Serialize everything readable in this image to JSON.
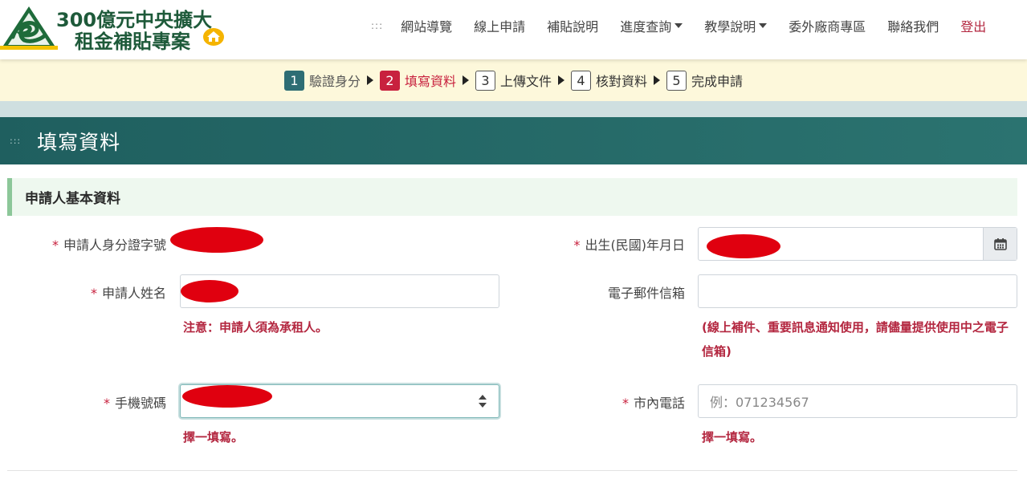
{
  "logo": {
    "line1": "300億元中央擴大",
    "line2": "租金補貼專案"
  },
  "nav": {
    "dots": ":::",
    "items": [
      {
        "label": "網站導覽",
        "dropdown": false
      },
      {
        "label": "線上申請",
        "dropdown": false
      },
      {
        "label": "補貼說明",
        "dropdown": false
      },
      {
        "label": "進度查詢",
        "dropdown": true
      },
      {
        "label": "教學說明",
        "dropdown": true
      },
      {
        "label": "委外廠商專區",
        "dropdown": false
      }
    ],
    "contact": "聯絡我們",
    "logout": "登出"
  },
  "steps": [
    {
      "num": "1",
      "label": "驗證身分",
      "state": "done"
    },
    {
      "num": "2",
      "label": "填寫資料",
      "state": "active"
    },
    {
      "num": "3",
      "label": "上傳文件",
      "state": "pending"
    },
    {
      "num": "4",
      "label": "核對資料",
      "state": "pending"
    },
    {
      "num": "5",
      "label": "完成申請",
      "state": "pending"
    }
  ],
  "page": {
    "dots": ":::",
    "title": "填寫資料"
  },
  "section": {
    "title": "申請人基本資料"
  },
  "form": {
    "required_mark": "*",
    "id_label": "申請人身分證字號",
    "birth_label": "出生(民國)年月日",
    "name_label": "申請人姓名",
    "name_note": "注意：申請人須為承租人。",
    "email_label": "電子郵件信箱",
    "email_note": "(線上補件、重要訊息通知使用，請儘量提供使用中之電子信箱)",
    "mobile_label": "手機號碼",
    "mobile_note": "擇一填寫。",
    "phone_label": "市內電話",
    "phone_placeholder": "例：071234567",
    "phone_note": "擇一填寫。"
  },
  "colors": {
    "brand_green": "#1e5a3a",
    "teal": "#2e6d74",
    "active_red": "#c8213e",
    "steps_bg": "#fdf8db",
    "section_bg": "#eef8ef"
  }
}
